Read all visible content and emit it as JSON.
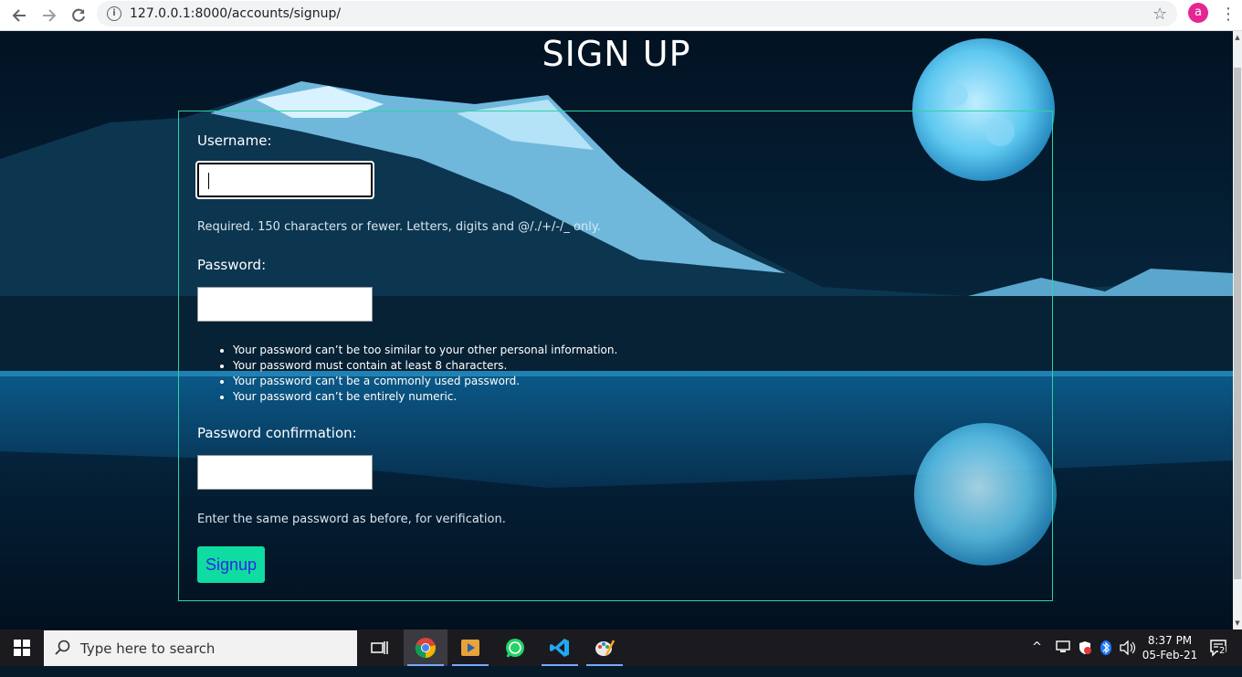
{
  "browser": {
    "url": "127.0.0.1:8000/accounts/signup/",
    "profile_initial": "a"
  },
  "page": {
    "title": "SIGN UP",
    "username_label": "Username:",
    "username_help": "Required. 150 characters or fewer. Letters, digits and @/./+/-/_ only.",
    "password_label": "Password:",
    "password_rules": [
      "Your password can’t be too similar to your other personal information.",
      "Your password must contain at least 8 characters.",
      "Your password can’t be a commonly used password.",
      "Your password can’t be entirely numeric."
    ],
    "password_confirm_label": "Password confirmation:",
    "password_confirm_help": "Enter the same password as before, for verification.",
    "signup_button": "Signup"
  },
  "colors": {
    "form_border": "#2ed3a2",
    "button_bg": "#0fdca0",
    "button_text": "#2a2ae0"
  },
  "taskbar": {
    "search_placeholder": "Type here to search",
    "time": "8:37 PM",
    "date": "05-Feb-21",
    "notification_count": "2",
    "apps": [
      "task-view-icon",
      "chrome-icon",
      "media-player-icon",
      "whatsapp-icon",
      "vscode-icon",
      "paint-icon"
    ]
  }
}
